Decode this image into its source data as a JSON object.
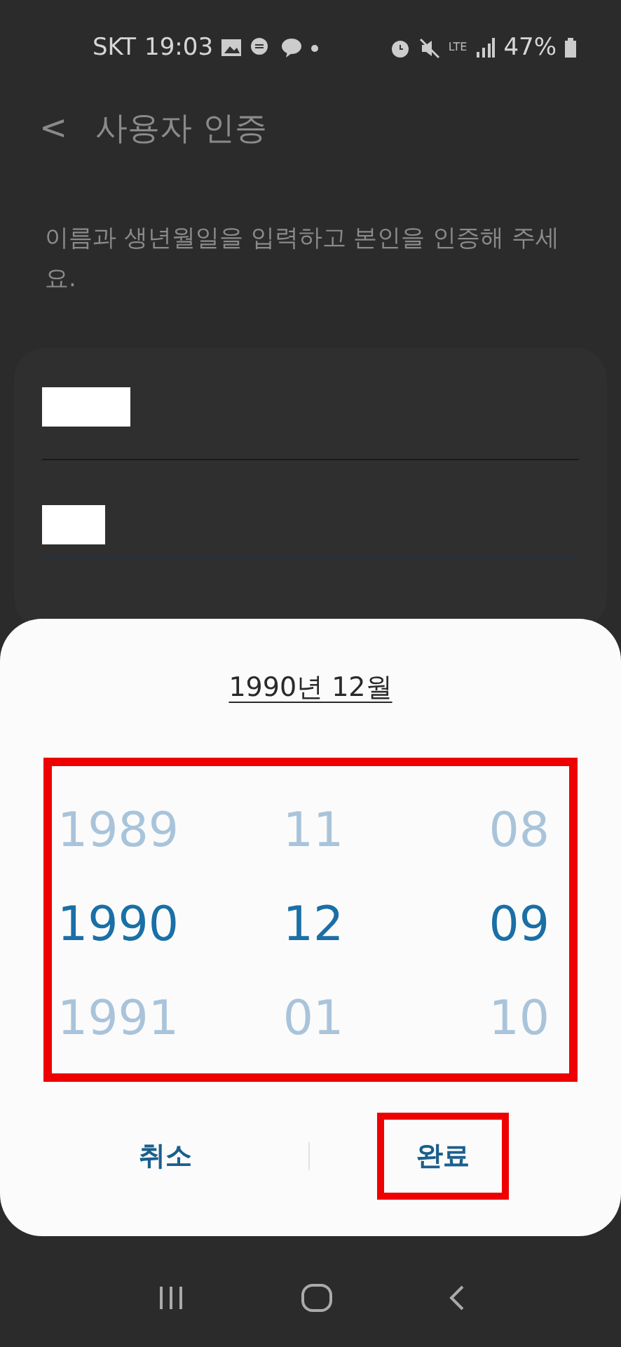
{
  "status_bar": {
    "carrier": "SKT",
    "time": "19:03",
    "network": "LTE",
    "battery": "47%"
  },
  "header": {
    "back": "<",
    "title": "사용자 인증"
  },
  "description": "이름과 생년월일을 입력하고 본인을 인증해 주세요.",
  "form": {
    "fields": [
      {
        "redacted": true,
        "focused": false
      },
      {
        "redacted": true,
        "focused": true
      }
    ]
  },
  "dialog": {
    "title": "1990년 12월",
    "columns": [
      {
        "items": [
          {
            "text": "1989",
            "selected": false
          },
          {
            "text": "1990",
            "selected": true
          },
          {
            "text": "1991",
            "selected": false
          }
        ]
      },
      {
        "items": [
          {
            "text": "11",
            "selected": false
          },
          {
            "text": "12",
            "selected": true
          },
          {
            "text": "01",
            "selected": false
          }
        ]
      },
      {
        "items": [
          {
            "text": "08",
            "selected": false
          },
          {
            "text": "09",
            "selected": true
          },
          {
            "text": "10",
            "selected": false
          }
        ]
      }
    ],
    "highlighted_picker": true,
    "buttons": [
      {
        "label": "취소",
        "highlighted": false
      },
      {
        "label": "완료",
        "highlighted": true
      }
    ]
  }
}
